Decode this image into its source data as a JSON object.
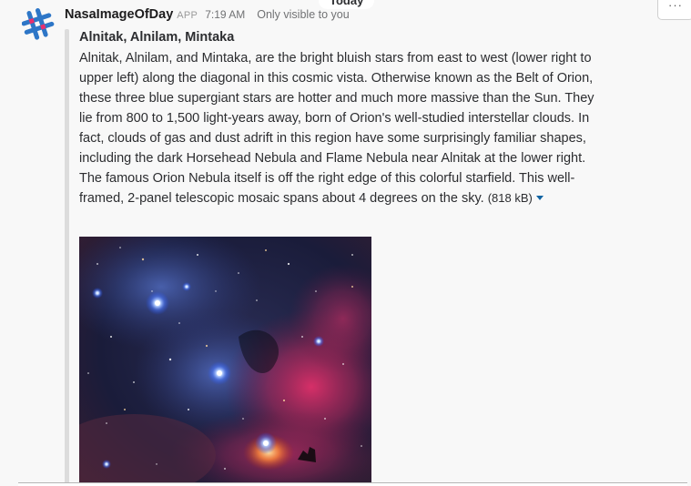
{
  "day_divider": "Today",
  "message": {
    "bot_name": "NasaImageOfDay",
    "app_badge": "APP",
    "time": "7:19 AM",
    "visibility": "Only visible to you",
    "avatar_icon": "slack-hash-icon"
  },
  "attachment": {
    "title": "Alnitak, Alnilam, Mintaka",
    "description": "Alnitak, Alnilam, and Mintaka, are the bright bluish stars from east to west (lower right to upper left) along the diagonal in this cosmic vista. Otherwise known as the Belt of Orion, these three blue supergiant stars are hotter and much more massive than the Sun. They lie from 800 to 1,500 light-years away, born of Orion's well-studied interstellar clouds. In fact, clouds of gas and dust adrift in this region have some surprisingly familiar shapes, including the dark Horsehead Nebula and Flame Nebula near Alnitak at the lower right. The famous Orion Nebula itself is off the right edge of this colorful starfield. This well-framed, 2-panel telescopic mosaic spans about 4 degrees on the sky.",
    "file_size": "(818 kB)",
    "image_subject": "orion-belt-nebula-photo"
  },
  "actions": {
    "more_icon": "more-actions-icon",
    "more_label": "···"
  },
  "colors": {
    "accent_link": "#1264a3",
    "attachment_bar": "#dcdcdc",
    "background": "#f8f8f8"
  }
}
